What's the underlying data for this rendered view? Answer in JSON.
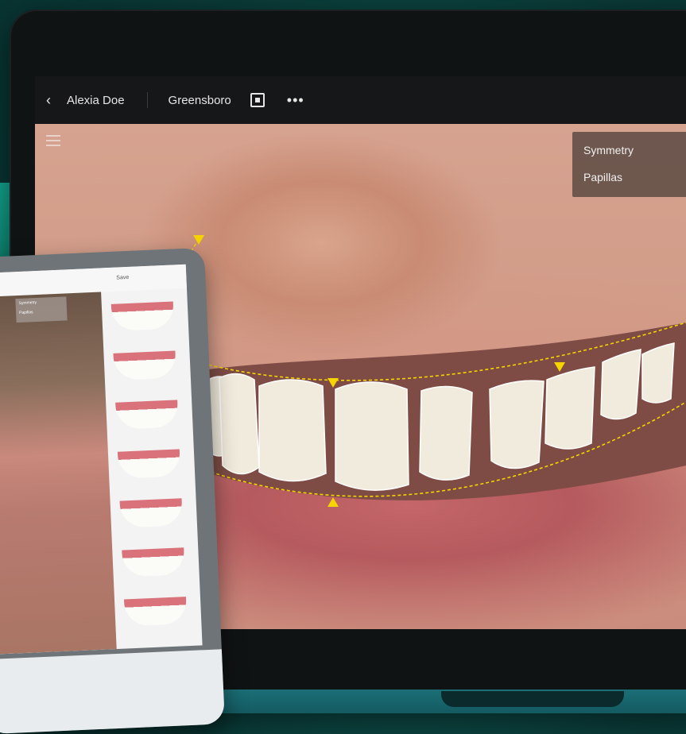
{
  "toolbar": {
    "back_icon": "chevron-left-icon",
    "patient_name": "Alexia Doe",
    "location": "Greensboro",
    "more_label": "•••"
  },
  "overlay_panel": {
    "options": [
      "Symmetry",
      "Papillas"
    ]
  },
  "tablet": {
    "top_label": "Save",
    "panel_options": [
      "Symmetry",
      "Papillas"
    ]
  },
  "colors": {
    "guide_yellow": "#f5d400",
    "background_teal": "#0a3a37"
  }
}
